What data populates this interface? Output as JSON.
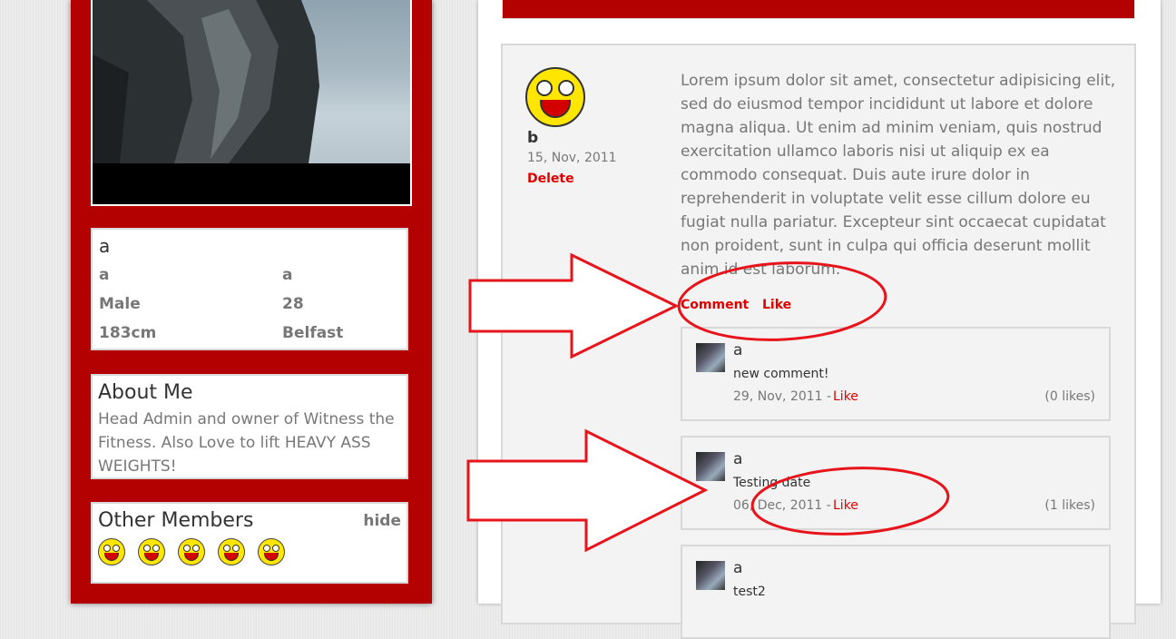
{
  "profile": {
    "name": "a",
    "fields": [
      {
        "left": "a",
        "right": "a"
      },
      {
        "left": "Male",
        "right": "28"
      },
      {
        "left": "183cm",
        "right": "Belfast"
      }
    ],
    "about_title": "About Me",
    "about_text": "Head Admin and owner of Witness the Fitness. Also Love to lift HEAVY ASS WEIGHTS!",
    "members_title": "Other Members",
    "members_hide": "hide",
    "member_icons": [
      "smiley-icon",
      "smiley-icon",
      "smiley-icon",
      "smiley-icon",
      "smiley-icon"
    ]
  },
  "post": {
    "author": "b",
    "date": "15, Nov, 2011",
    "delete_label": "Delete",
    "body": "Lorem ipsum dolor sit amet, consectetur adipisicing elit, sed do eiusmod tempor incididunt ut labore et dolore magna aliqua. Ut enim ad minim veniam, quis nostrud exercitation ullamco laboris nisi ut aliquip ex ea commodo consequat. Duis aute irure dolor in reprehenderit in voluptate velit esse cillum dolore eu fugiat nulla pariatur. Excepteur sint occaecat cupidatat non proident, sunt in culpa qui officia deserunt mollit anim id est laborum.",
    "comment_label": "Comment",
    "like_label": "Like"
  },
  "comments": [
    {
      "name": "a",
      "text": "new comment!",
      "date": "29, Nov, 2011 -",
      "like": "Like",
      "likes": "(0 likes)"
    },
    {
      "name": "a",
      "text": "Testing date",
      "date": "06, Dec, 2011 -",
      "like": "Like",
      "likes": "(1 likes)"
    },
    {
      "name": "a",
      "text": "test2"
    }
  ],
  "colors": {
    "brand_red": "#b30000",
    "link_red": "#e00000",
    "annotation_red": "#e8141c"
  }
}
